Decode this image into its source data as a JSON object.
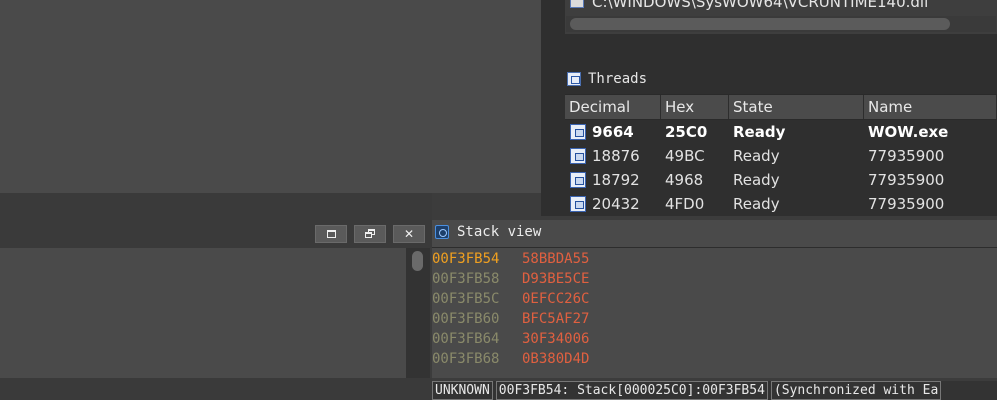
{
  "modules": {
    "partial_row_path": "C:\\WINDOWS\\SysWOW64\\VCRUNTIME140.dll"
  },
  "threads": {
    "title": "Threads",
    "columns": [
      "Decimal",
      "Hex",
      "State",
      "Name"
    ],
    "rows": [
      {
        "decimal": "9664",
        "hex": "25C0",
        "state": "Ready",
        "name": "WOW.exe",
        "current": true
      },
      {
        "decimal": "18876",
        "hex": "49BC",
        "state": "Ready",
        "name": "77935900",
        "current": false
      },
      {
        "decimal": "18792",
        "hex": "4968",
        "state": "Ready",
        "name": "77935900",
        "current": false
      },
      {
        "decimal": "20432",
        "hex": "4FD0",
        "state": "Ready",
        "name": "77935900",
        "current": false
      }
    ]
  },
  "window_buttons": {
    "maximize_icon": "maximize-icon",
    "restore_icon": "restore-icon",
    "close_label": "✕"
  },
  "stack": {
    "title": "Stack view",
    "rows": [
      {
        "address": "00F3FB54",
        "value": "58BBDA55",
        "current": true
      },
      {
        "address": "00F3FB58",
        "value": "D93BE5CE",
        "current": false
      },
      {
        "address": "00F3FB5C",
        "value": "0EFCC26C",
        "current": false
      },
      {
        "address": "00F3FB60",
        "value": "BFC5AF27",
        "current": false
      },
      {
        "address": "00F3FB64",
        "value": "30F34006",
        "current": false
      },
      {
        "address": "00F3FB68",
        "value": "0B380D4D",
        "current": false
      }
    ]
  },
  "status_bar": {
    "segment_1": "UNKNOWN",
    "segment_2": "00F3FB54: Stack[000025C0]:00F3FB54",
    "segment_3": "(Synchronized with Ea"
  },
  "colors": {
    "current_address": "#f0a020",
    "address": "#8a8a6a",
    "value": "#e06040"
  }
}
